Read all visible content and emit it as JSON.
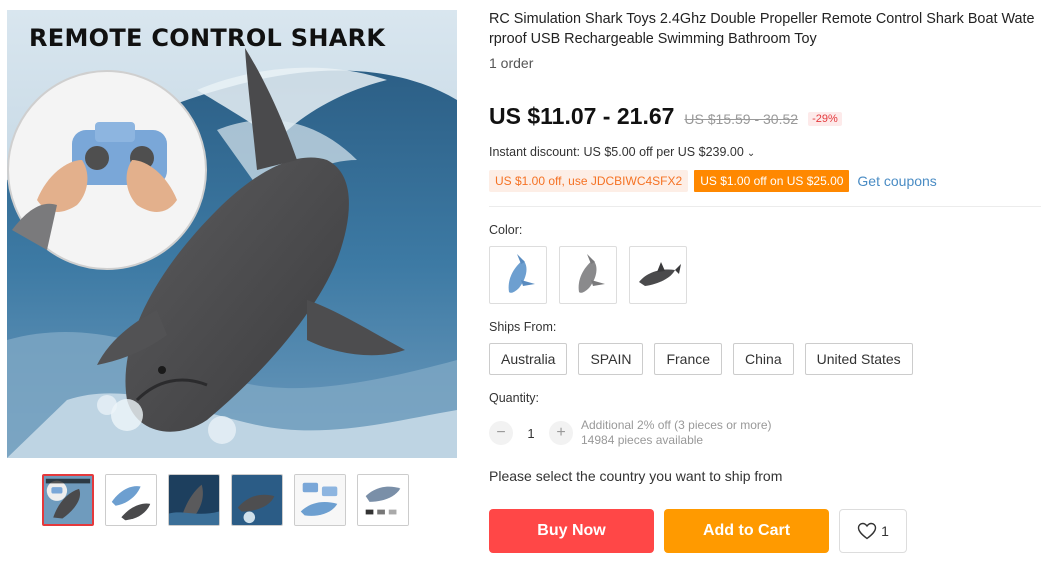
{
  "gallery": {
    "overlay_title": "REMOTE CONTROL SHARK",
    "thumbnail_count": 6,
    "selected_thumbnail": 1
  },
  "product": {
    "title": "RC Simulation Shark Toys 2.4Ghz Double Propeller Remote Control Shark Boat Waterproof USB Rechargeable Swimming Bathroom Toy",
    "orders": "1 order",
    "price": "US $11.07 - 21.67",
    "original_price": "US $15.59 - 30.52",
    "discount": "-29%",
    "instant_discount": "Instant discount: US $5.00 off per US $239.00",
    "coupons": [
      "US $1.00 off, use JDCBIWC4SFX2",
      "US $1.00 off on US $25.00"
    ],
    "get_coupons": "Get coupons"
  },
  "color": {
    "label": "Color:",
    "options": [
      "blue-shark-icon",
      "grey-shark-icon",
      "dark-shark-icon"
    ]
  },
  "ships_from": {
    "label": "Ships From:",
    "options": [
      "Australia",
      "SPAIN",
      "France",
      "China",
      "United States"
    ]
  },
  "quantity": {
    "label": "Quantity:",
    "value": "1",
    "minus": "−",
    "plus": "+",
    "note_discount": "Additional 2% off (3 pieces or more)",
    "note_available": "14984 pieces available"
  },
  "ship_message": "Please select the country you want to ship from",
  "actions": {
    "buy_now": "Buy Now",
    "add_to_cart": "Add to Cart",
    "wishlist_count": "1"
  },
  "colors": {
    "buy_now": "#ff4747",
    "add_to_cart": "#ff9a00",
    "coupon_solid": "#ff8800",
    "link": "#4a8cc4"
  }
}
